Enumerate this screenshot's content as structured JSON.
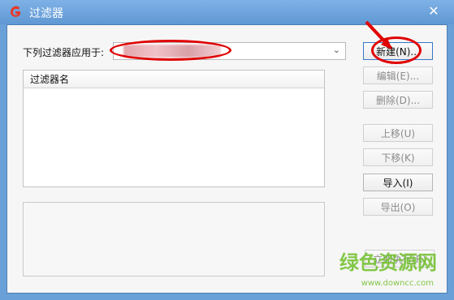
{
  "window": {
    "title": "过滤器",
    "app_icon": "app-icon-g",
    "close_icon": "close-icon"
  },
  "apply": {
    "label": "下列过滤器应用于:",
    "selected_value": "",
    "dropdown_icon": "chevron-down-icon"
  },
  "list": {
    "header": "过滤器名"
  },
  "buttons": {
    "new": "新建(N)...",
    "edit": "编辑(E)...",
    "delete": "删除(D)...",
    "move_up": "上移(U)",
    "move_down": "下移(K)",
    "import": "导入(I)",
    "export": "导出(O)",
    "run_now": "立即执行(R)"
  },
  "watermark": {
    "title": "绿色资源网",
    "url": "www.downcc.com"
  },
  "colors": {
    "titlebar": "#5f98d4",
    "annotation_red": "#e00000",
    "watermark_green": "#6fbf2a"
  }
}
